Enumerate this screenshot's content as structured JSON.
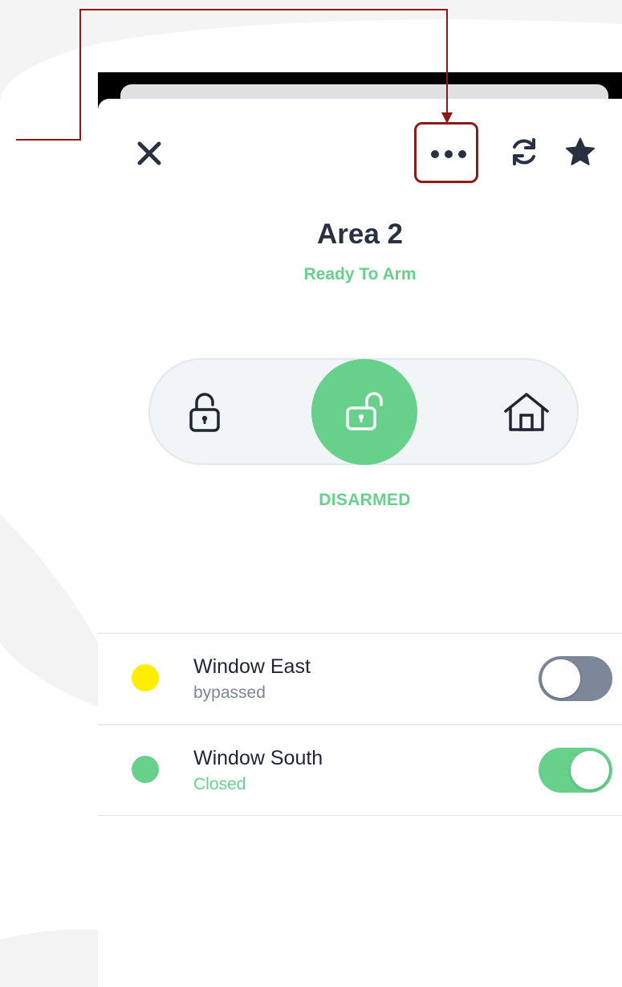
{
  "header": {
    "close_icon": "close-icon",
    "more_icon": "more-horizontal-icon",
    "refresh_icon": "refresh-icon",
    "favorite_icon": "star-icon"
  },
  "area": {
    "title": "Area 2",
    "status": "Ready To Arm"
  },
  "arm_modes": {
    "items": [
      {
        "icon": "lock-icon",
        "selected": false
      },
      {
        "icon": "unlock-icon",
        "selected": true
      },
      {
        "icon": "home-icon",
        "selected": false
      }
    ],
    "current_label": "DISARMED"
  },
  "zones": [
    {
      "name": "Window East",
      "state": "bypassed",
      "dot_color": "#ffee00",
      "state_color": "#7a8596",
      "toggle_on": false,
      "toggle_color": "#7d879a"
    },
    {
      "name": "Window South",
      "state": "Closed",
      "dot_color": "#67d18c",
      "state_color": "#67d18c",
      "toggle_on": true,
      "toggle_color": "#67d18c"
    }
  ],
  "colors": {
    "accent_green": "#67d18c",
    "title_dark": "#273142",
    "callout_red": "#8b1a1a"
  }
}
